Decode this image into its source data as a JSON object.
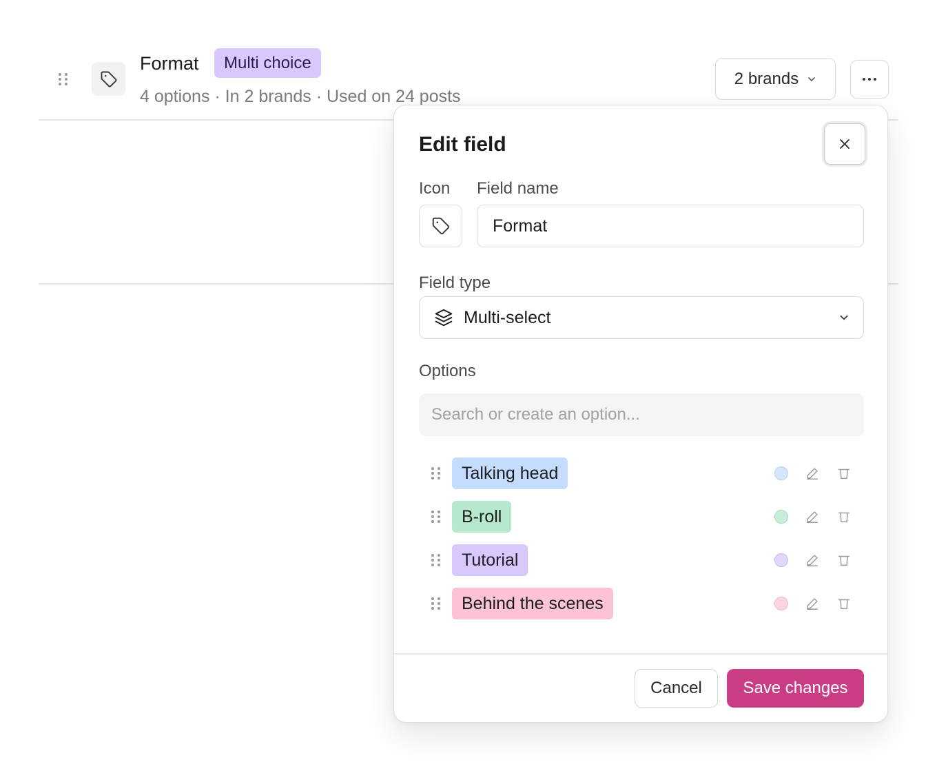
{
  "field_row": {
    "title": "Format",
    "badge": "Multi choice",
    "meta": "4 options · In 2 brands · Used on 24 posts",
    "brands_button_label": "2 brands",
    "icon": "tag-icon",
    "badge_color": "#d9c8fd"
  },
  "edit_field": {
    "title": "Edit field",
    "icon_label": "Icon",
    "name_label": "Field name",
    "name_value": "Format",
    "type_label": "Field type",
    "type_value": "Multi-select",
    "type_icon": "layers-icon",
    "options_label": "Options",
    "search_placeholder": "Search or create an option...",
    "options": [
      {
        "label": "Talking head",
        "color": "#c4dcfd",
        "swatch": "#d6e7fd",
        "swatch_border": "#b3cff5"
      },
      {
        "label": "B-roll",
        "color": "#b5e8cc",
        "swatch": "#c9eed9",
        "swatch_border": "#a7dbbd"
      },
      {
        "label": "Tutorial",
        "color": "#d9c8fd",
        "swatch": "#e2d6fd",
        "swatch_border": "#c9b6f5"
      },
      {
        "label": "Behind the scenes",
        "color": "#fcc3d6",
        "swatch": "#fdd4e1",
        "swatch_border": "#f3b5c9"
      }
    ],
    "cancel_label": "Cancel",
    "save_label": "Save changes",
    "save_color": "#c93d85"
  }
}
